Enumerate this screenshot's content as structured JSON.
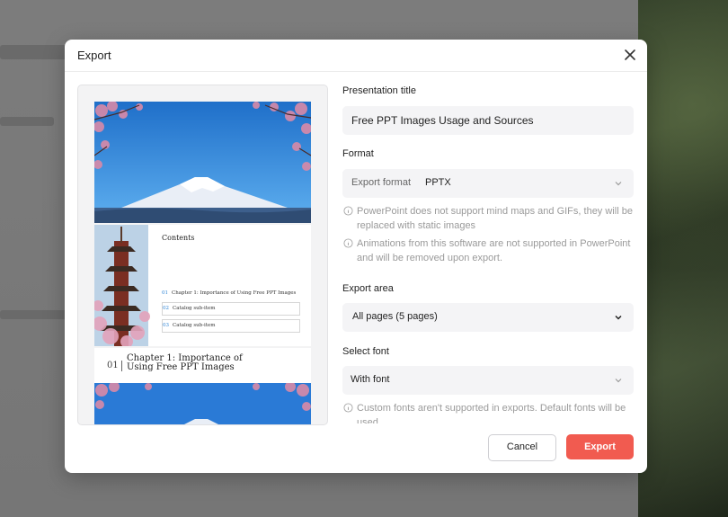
{
  "modal": {
    "title": "Export",
    "presentation_title_label": "Presentation title",
    "presentation_title_value": "Free PPT Images Usage and Sources",
    "format_label": "Format",
    "export_format_label": "Export format",
    "export_format_value": "PPTX",
    "notes": [
      "PowerPoint does not support mind maps and GIFs, they will be replaced with static images",
      "Animations from this software are not supported in PowerPoint and will be removed upon export."
    ],
    "export_area_label": "Export area",
    "export_area_value": "All pages (5 pages)",
    "select_font_label": "Select font",
    "select_font_value": "With font",
    "font_note": "Custom fonts aren't supported in exports. Default fonts will be used",
    "cancel_label": "Cancel",
    "export_label": "Export"
  },
  "preview": {
    "contents_title": "Contents",
    "toc": [
      {
        "num": "01",
        "text": "Chapter 1: Importance of Using Free PPT Images"
      },
      {
        "num": "02",
        "text": "Catalog sub-item"
      },
      {
        "num": "03",
        "text": "Catalog sub-item"
      }
    ],
    "chapter_num": "01",
    "chapter_title": "Chapter 1: Importance of Using Free PPT Images"
  },
  "colors": {
    "accent": "#f15b50",
    "sky": "#2f86d6",
    "blossom": "#d98aa8"
  }
}
